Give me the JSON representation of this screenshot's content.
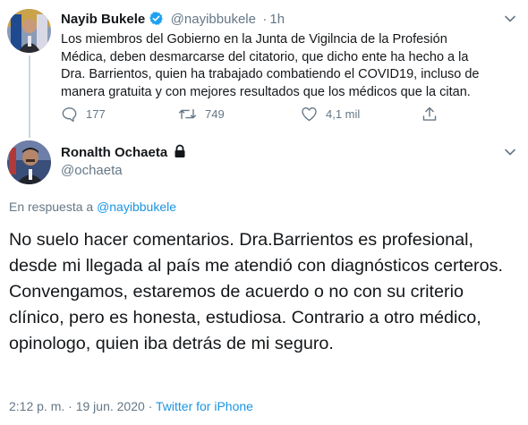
{
  "tweet1": {
    "author_name": "Nayib Bukele",
    "author_handle": "@nayibbukele",
    "separator": "·",
    "time": "1h",
    "text": "Los miembros del Gobierno en la Junta de Vigilncia de la Profesión Médica, deben desmarcarse del citatorio, que dicho ente ha hecho a la Dra. Barrientos, quien ha trabajado combatiendo el COVID19, incluso de manera gratuita y con mejores resultados que los médicos que la citan.",
    "replies": "177",
    "retweets": "749",
    "likes": "4,1 mil",
    "verified_color": "#1da1f2"
  },
  "tweet2": {
    "author_name": "Ronalth Ochaeta",
    "author_handle": "@ochaeta",
    "reply_prefix": "En respuesta a",
    "reply_target": "@nayibbukele",
    "text": "No suelo hacer comentarios. Dra.Barrientos es profesional, desde mi llegada al país me atendió con diagnósticos certeros. Convengamos, estaremos de acuerdo o no con su criterio clínico, pero es honesta, estudiosa. Contrario a otro médico, opinologo, quien iba detrás de mi seguro.",
    "time": "2:12 p. m.",
    "separator": "·",
    "date": "19 jun. 2020",
    "source": "Twitter for iPhone"
  },
  "colors": {
    "text": "#14171a",
    "secondary": "#657786",
    "link": "#1b95e0",
    "thread_line": "#ccd6dd"
  },
  "icons": {
    "reply": "reply-icon",
    "retweet": "retweet-icon",
    "like": "heart-icon",
    "share": "share-icon",
    "more": "chevron-down-icon",
    "protected": "lock-icon",
    "verified": "verified-badge-icon"
  }
}
